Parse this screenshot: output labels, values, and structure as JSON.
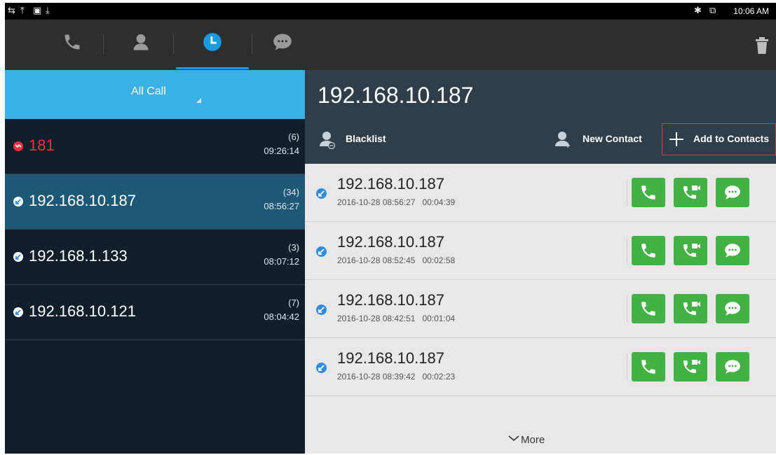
{
  "status_bar": {
    "left_icons": [
      "usb-icon",
      "upload-icon",
      "image-icon",
      "download-icon"
    ],
    "right_icons": [
      "bluetooth-icon",
      "display-icon"
    ],
    "time": "10:06 AM"
  },
  "tabs": [
    {
      "name": "phone",
      "icon": "phone-icon"
    },
    {
      "name": "contacts",
      "icon": "contact-icon"
    },
    {
      "name": "history",
      "icon": "clock-icon",
      "active": true
    },
    {
      "name": "messages",
      "icon": "message-icon"
    }
  ],
  "filter": {
    "label": "All Call"
  },
  "calls": [
    {
      "number": "181",
      "count": "(6)",
      "time": "09:26:14",
      "missed": true
    },
    {
      "number": "192.168.10.187",
      "count": "(34)",
      "time": "08:56:27",
      "selected": true
    },
    {
      "number": "192.168.1.133",
      "count": "(3)",
      "time": "08:07:12"
    },
    {
      "number": "192.168.10.121",
      "count": "(7)",
      "time": "08:04:42"
    }
  ],
  "detail": {
    "title": "192.168.10.187",
    "actions": {
      "blacklist": "Blacklist",
      "new_contact": "New Contact",
      "add_to_contacts": "Add to Contacts"
    },
    "history": [
      {
        "number": "192.168.10.187",
        "datetime": "2016-10-28 08:56:27",
        "duration": "00:04:39"
      },
      {
        "number": "192.168.10.187",
        "datetime": "2016-10-28 08:52:45",
        "duration": "00:02:58"
      },
      {
        "number": "192.168.10.187",
        "datetime": "2016-10-28 08:42:51",
        "duration": "00:01:04"
      },
      {
        "number": "192.168.10.187",
        "datetime": "2016-10-28 08:39:42",
        "duration": "00:02:23"
      }
    ],
    "more_label": "More"
  },
  "colors": {
    "accent": "#3bb0e4",
    "green": "#41b243",
    "missed": "#e8323a",
    "highlight_box": "#e53935"
  }
}
